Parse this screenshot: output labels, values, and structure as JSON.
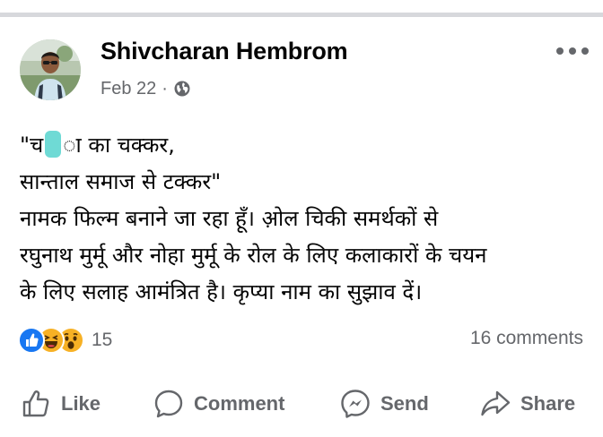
{
  "post": {
    "author_name": "Shivcharan Hembrom",
    "date": "Feb 22",
    "separator": "·",
    "privacy_icon": "globe-icon",
    "more_icon": "more-horizontal-icon",
    "text_lines": [
      {
        "before": "\"च",
        "after": "ा का चक्कर,"
      },
      {
        "text": "सान्ताल समाज से टक्कर\""
      },
      {
        "text": "नामक फिल्म बनाने जा रहा हूँ। ओ़ल चिकी समर्थकों से"
      },
      {
        "text": "रघुनाथ मुर्मू और नोहा मुर्मू के रोल के लिए कलाकारों के चयन"
      },
      {
        "text": "के लिए सलाह आमंत्रित है। कृप्या नाम का सुझाव दें।"
      }
    ]
  },
  "reactions": {
    "icons": [
      "like-reaction-icon",
      "haha-reaction-icon",
      "wow-reaction-icon"
    ],
    "count": "15",
    "like_color": "#1877f2",
    "emoji_color": "#f7b125"
  },
  "comments_count": "16 comments",
  "actions": {
    "like": {
      "label": "Like",
      "icon": "thumbs-up-icon"
    },
    "comment": {
      "label": "Comment",
      "icon": "comment-bubble-icon"
    },
    "send": {
      "label": "Send",
      "icon": "messenger-icon"
    },
    "share": {
      "label": "Share",
      "icon": "share-arrow-icon"
    }
  },
  "colors": {
    "secondary_text": "#65676b",
    "primary_text": "#050505",
    "divider": "#d7d8dc"
  }
}
